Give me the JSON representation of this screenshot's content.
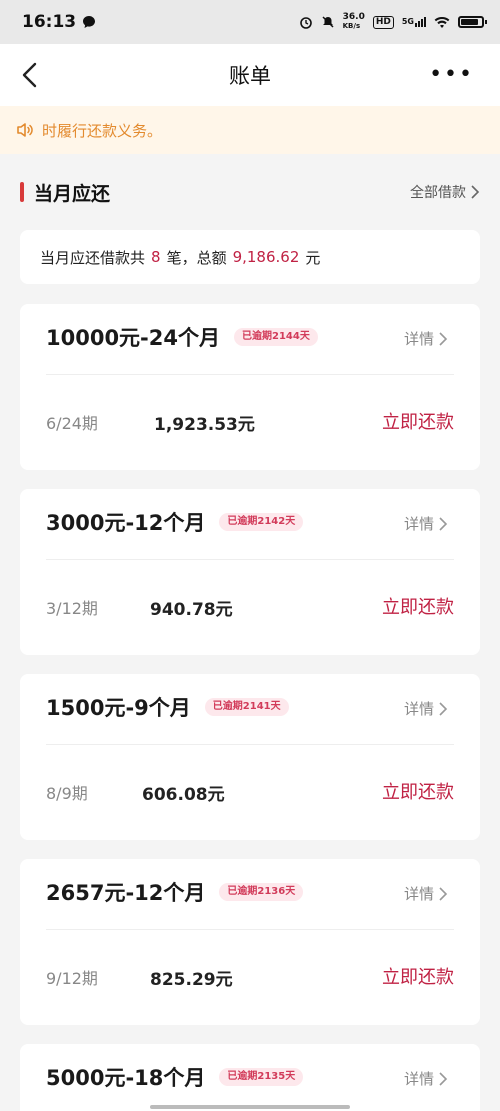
{
  "status_bar": {
    "time": "16:13",
    "network_speed": "36.0",
    "network_unit": "KB/s",
    "hd": "HD",
    "signal": "5G"
  },
  "nav": {
    "title": "账单"
  },
  "notice": {
    "text": "时履行还款义务。"
  },
  "section": {
    "title": "当月应还",
    "all_loans": "全部借款"
  },
  "summary": {
    "prefix": "当月应还借款共",
    "count": "8",
    "mid": "笔，总额",
    "total": "9,186.62",
    "suffix": "元"
  },
  "cards": [
    {
      "title": "10000元-24个月",
      "badge": "已逾期2144天",
      "detail": "详情",
      "period": "6/24期",
      "amount": "1,923.53元",
      "action": "立即还款"
    },
    {
      "title": "3000元-12个月",
      "badge": "已逾期2142天",
      "detail": "详情",
      "period": "3/12期",
      "amount": "940.78元",
      "action": "立即还款"
    },
    {
      "title": "1500元-9个月",
      "badge": "已逾期2141天",
      "detail": "详情",
      "period": "8/9期",
      "amount": "606.08元",
      "action": "立即还款"
    },
    {
      "title": "2657元-12个月",
      "badge": "已逾期2136天",
      "detail": "详情",
      "period": "9/12期",
      "amount": "825.29元",
      "action": "立即还款"
    },
    {
      "title": "5000元-18个月",
      "badge": "已逾期2135天",
      "detail": "详情"
    }
  ]
}
